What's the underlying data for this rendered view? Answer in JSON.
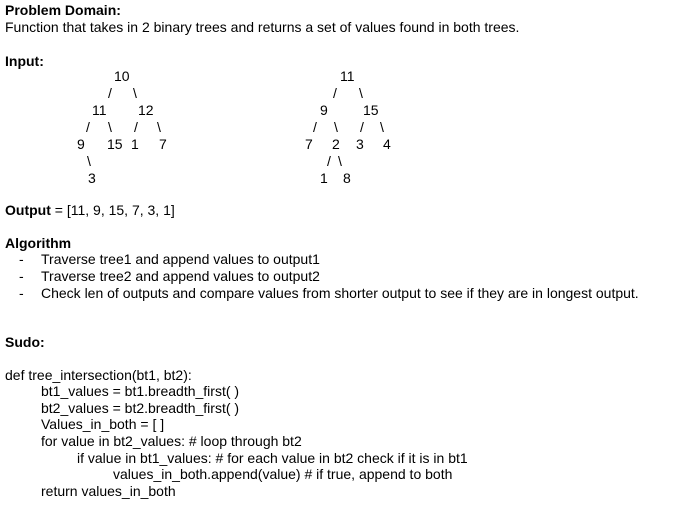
{
  "problem_domain": {
    "heading": "Problem Domain:",
    "text": "Function that takes in 2 binary trees and returns a set of values found in both trees."
  },
  "input": {
    "heading": "Input:",
    "tree1": {
      "rows": [
        [
          "10"
        ],
        [
          "/",
          "\\"
        ],
        [
          "11",
          "12"
        ],
        [
          "/",
          "\\",
          "/",
          "\\"
        ],
        [
          "9",
          "15",
          "1",
          "7"
        ],
        [
          "\\"
        ],
        [
          "3"
        ]
      ]
    },
    "tree2": {
      "rows": [
        [
          "11"
        ],
        [
          "/",
          "\\"
        ],
        [
          "9",
          "15"
        ],
        [
          "/",
          "\\",
          "/",
          "\\"
        ],
        [
          "7",
          "2",
          "3",
          "4"
        ],
        [
          "/",
          "\\"
        ],
        [
          "1",
          "8"
        ]
      ]
    }
  },
  "output": {
    "heading": "Output",
    "text": " = [11, 9, 15, 7, 3, 1]"
  },
  "algorithm": {
    "heading": "Algorithm",
    "steps": [
      "Traverse tree1 and append values to output1",
      "Traverse tree2 and append values to output2",
      "Check len of outputs and compare values from shorter output to see if they are in longest output."
    ],
    "bullet": "-"
  },
  "sudo": {
    "heading": "Sudo:",
    "lines": [
      "def tree_intersection(bt1, bt2):",
      "bt1_values = bt1.breadth_first( )",
      "bt2_values = bt2.breadth_first( )",
      "Values_in_both = [ ]",
      "for value in bt2_values: # loop through bt2",
      "if value in bt1_values: # for each value in bt2 check if it is in bt1",
      "values_in_both.append(value) # if true, append to both",
      "return values_in_both"
    ]
  }
}
